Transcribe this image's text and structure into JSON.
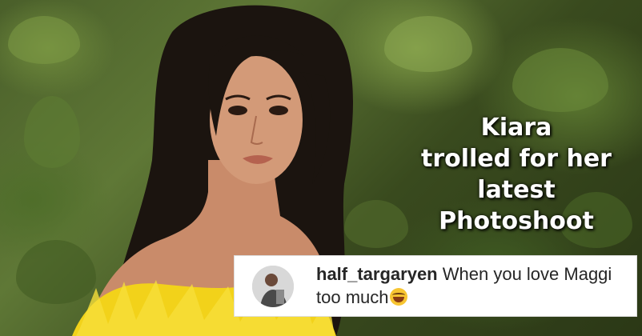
{
  "headline": {
    "lines": [
      "Kiara",
      "trolled for her",
      "latest",
      "Photoshoot"
    ]
  },
  "comment": {
    "username": "half_targaryen",
    "text_line1": "When you love Maggi",
    "text_line2": "too much",
    "emoji": "face-with-tears-of-joy-icon"
  },
  "colors": {
    "headline_text": "#ffffff",
    "comment_bg": "#ffffff",
    "comment_text": "#262626",
    "dress": "#f2d21a"
  }
}
